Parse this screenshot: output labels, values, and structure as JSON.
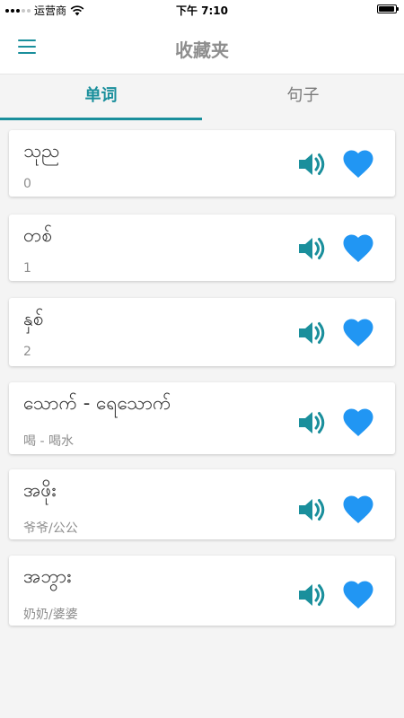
{
  "status_bar": {
    "carrier": "运营商",
    "time": "下午 7:10"
  },
  "header": {
    "title": "收藏夹"
  },
  "tabs": [
    {
      "label": "单词",
      "active": true
    },
    {
      "label": "句子",
      "active": false
    }
  ],
  "colors": {
    "accent": "#1a8f9c",
    "heart": "#2196f3",
    "title": "#8e8e8e"
  },
  "words": [
    {
      "word": "သုည",
      "meaning": "0"
    },
    {
      "word": "တစ်",
      "meaning": "1"
    },
    {
      "word": "နှစ်",
      "meaning": "2"
    },
    {
      "word": "သောက် - ရေသောက်",
      "meaning": "喝 - 喝水"
    },
    {
      "word": "အဖိုး",
      "meaning": "爷爷/公公"
    },
    {
      "word": "အဘွား",
      "meaning": "奶奶/婆婆"
    }
  ]
}
